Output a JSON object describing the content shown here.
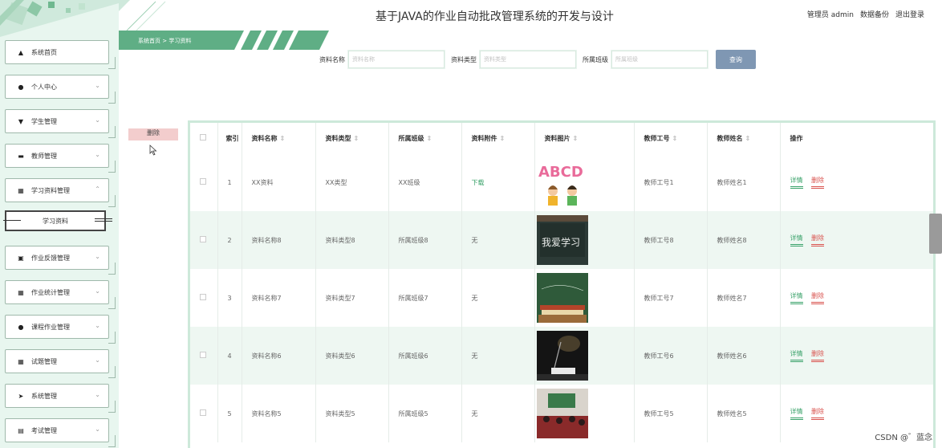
{
  "header": {
    "title": "基于JAVA的作业自动批改管理系统的开发与设计",
    "nav": [
      "管理员 admin",
      "数据备份",
      "退出登录"
    ]
  },
  "breadcrumb": {
    "text": "系统首页 > 学习资料"
  },
  "sidebar": {
    "items": [
      {
        "label": "系统首页",
        "icon": "home-icon"
      },
      {
        "label": "个人中心",
        "icon": "user-icon"
      },
      {
        "label": "学生管理",
        "icon": "student-icon"
      },
      {
        "label": "教师管理",
        "icon": "teacher-icon"
      },
      {
        "label": "学习资料管理",
        "icon": "grid-icon"
      },
      {
        "label": "作业反馈管理",
        "icon": "clipboard-icon"
      },
      {
        "label": "作业统计管理",
        "icon": "grid-icon"
      },
      {
        "label": "课程作业管理",
        "icon": "pin-icon"
      },
      {
        "label": "试题管理",
        "icon": "grid-icon"
      },
      {
        "label": "系统管理",
        "icon": "send-icon"
      },
      {
        "label": "考试管理",
        "icon": "bar-chart-icon"
      }
    ],
    "sub_item": "学习资料"
  },
  "search": {
    "fields": [
      {
        "label": "资料名称",
        "placeholder": "资料名称"
      },
      {
        "label": "资料类型",
        "placeholder": "资料类型"
      },
      {
        "label": "所属班级",
        "placeholder": "所属班级"
      }
    ],
    "button": "查询"
  },
  "bulk_delete": "删除",
  "table": {
    "columns": [
      "索引",
      "资料名称",
      "资料类型",
      "所属班级",
      "资料附件",
      "资料图片",
      "教师工号",
      "教师姓名",
      "操作"
    ],
    "rows": [
      {
        "idx": "1",
        "name": "XX资料",
        "type": "XX类型",
        "cls": "XX班级",
        "att": "下载",
        "tno": "教师工号1",
        "tname": "教师姓名1"
      },
      {
        "idx": "2",
        "name": "资料名称8",
        "type": "资料类型8",
        "cls": "所属班级8",
        "att": "无",
        "tno": "教师工号8",
        "tname": "教师姓名8"
      },
      {
        "idx": "3",
        "name": "资料名称7",
        "type": "资料类型7",
        "cls": "所属班级7",
        "att": "无",
        "tno": "教师工号7",
        "tname": "教师姓名7"
      },
      {
        "idx": "4",
        "name": "资料名称6",
        "type": "资料类型6",
        "cls": "所属班级6",
        "att": "无",
        "tno": "教师工号6",
        "tname": "教师姓名6"
      },
      {
        "idx": "5",
        "name": "资料名称5",
        "type": "资料类型5",
        "cls": "所属班级5",
        "att": "无",
        "tno": "教师工号5",
        "tname": "教师姓名5"
      }
    ],
    "actions": {
      "detail": "详情",
      "delete": "删除"
    },
    "image_text": {
      "abcd": "ABCD",
      "blackboard": "我爱学习"
    }
  },
  "watermark": "CSDN @゛蓝念",
  "colors": {
    "accent": "#4fa97a",
    "query_button": "#7f97b3",
    "delete": "#d9534f"
  }
}
